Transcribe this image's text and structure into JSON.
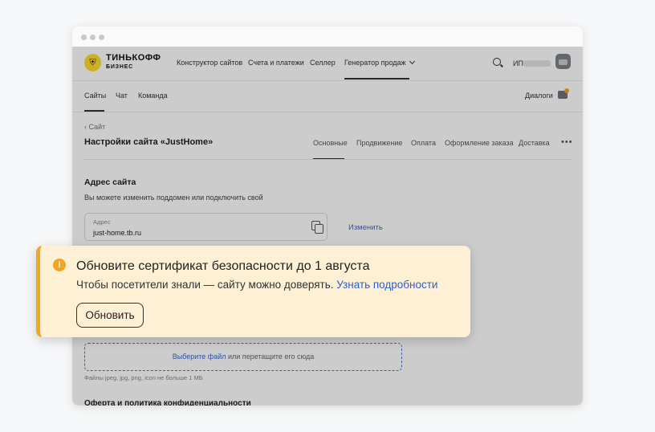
{
  "brand": {
    "name": "ТИНЬКОФФ",
    "sub": "БИЗНЕС"
  },
  "topnav": {
    "items": [
      "Конструктор сайтов",
      "Счета и платежи",
      "Селлер",
      "Генератор продаж"
    ],
    "user_prefix": "ИП"
  },
  "subnav": {
    "items": [
      "Сайты",
      "Чат",
      "Команда"
    ],
    "dialogs_label": "Диалоги"
  },
  "page": {
    "back_label": "Сайт",
    "title": "Настройки сайта «JustHome»",
    "tabs": [
      "Основные",
      "Продвижение",
      "Оплата",
      "Оформление заказа",
      "Доставка"
    ],
    "more": "•••"
  },
  "address": {
    "section_title": "Адрес сайта",
    "description": "Вы можете изменить поддомен или подключить свой",
    "field_label": "Адрес",
    "field_value": "just-home.tb.ru",
    "change_label": "Изменить"
  },
  "upload": {
    "link_text": "Выберите файл",
    "rest_text": " или перетащите его сюда",
    "hint": "Файлы jpeg, jpg, png, icon не больше 1 МБ"
  },
  "offer": {
    "title": "Оферта и политика конфиденциальности"
  },
  "banner": {
    "title": "Обновите сертификат безопасности до 1 августа",
    "text": "Чтобы посетители знали — сайту можно доверять. ",
    "link": "Узнать подробности",
    "button": "Обновить",
    "icon": "!"
  },
  "colors": {
    "accent": "#f2a623",
    "link": "#2f5fc4",
    "banner_bg": "#fdf0d5"
  }
}
